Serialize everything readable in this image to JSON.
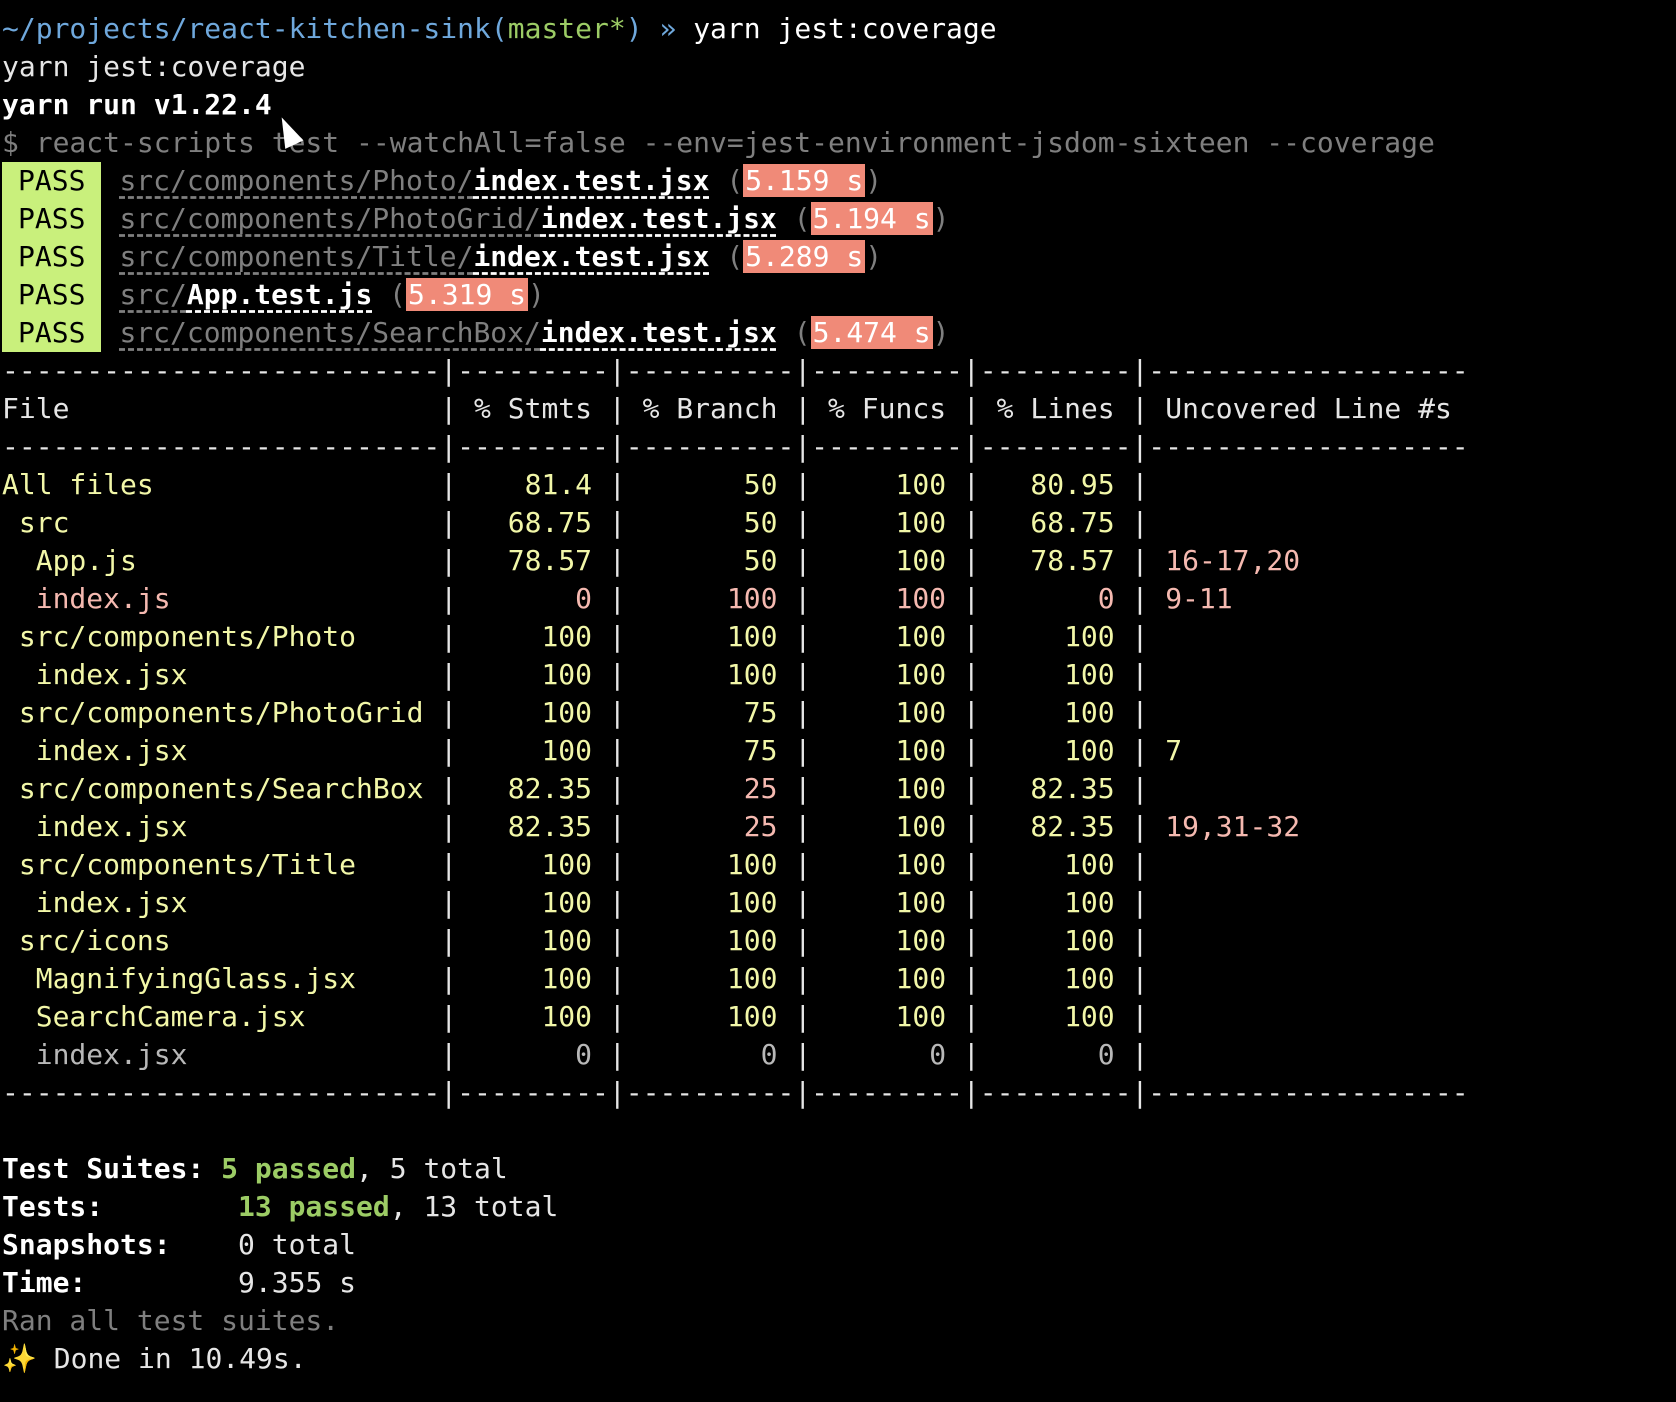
{
  "prompt": {
    "path": "~/projects/react-kitchen-sink",
    "branch": "master*",
    "arrow": "»",
    "command": "yarn jest:coverage"
  },
  "echo_command": "yarn jest:coverage",
  "yarn_version": "yarn run v1.22.4",
  "script_line": "$ react-scripts test --watchAll=false --env=jest-environment-jsdom-sixteen --coverage",
  "pass_label": "PASS",
  "test_results": [
    {
      "dir": "src/components/Photo/",
      "file": "index.test.jsx",
      "time": "5.159 s"
    },
    {
      "dir": "src/components/PhotoGrid/",
      "file": "index.test.jsx",
      "time": "5.194 s"
    },
    {
      "dir": "src/components/Title/",
      "file": "index.test.jsx",
      "time": "5.289 s"
    },
    {
      "dir": "src/",
      "file": "App.test.js",
      "time": "5.319 s"
    },
    {
      "dir": "src/components/SearchBox/",
      "file": "index.test.jsx",
      "time": "5.474 s"
    }
  ],
  "coverage": {
    "separator": "--------------------------|---------|----------|---------|---------|-------------------",
    "headers": [
      "File",
      "% Stmts",
      "% Branch",
      "% Funcs",
      "% Lines",
      "Uncovered Line #s"
    ],
    "rows": [
      {
        "indent": 0,
        "file": "All files",
        "stmts": "81.4",
        "branch": "50",
        "funcs": "100",
        "lines": "80.95",
        "uncovered": "",
        "color": "ycell"
      },
      {
        "indent": 1,
        "file": "src",
        "stmts": "68.75",
        "branch": "50",
        "funcs": "100",
        "lines": "68.75",
        "uncovered": "",
        "color": "ycell"
      },
      {
        "indent": 2,
        "file": "App.js",
        "stmts": "78.57",
        "branch": "50",
        "funcs": "100",
        "lines": "78.57",
        "uncovered": "16-17,20",
        "color": "ycell"
      },
      {
        "indent": 2,
        "file": "index.js",
        "stmts": "0",
        "branch": "100",
        "funcs": "100",
        "lines": "0",
        "uncovered": "9-11",
        "color": "red"
      },
      {
        "indent": 1,
        "file": "src/components/Photo",
        "stmts": "100",
        "branch": "100",
        "funcs": "100",
        "lines": "100",
        "uncovered": "",
        "color": "ycell"
      },
      {
        "indent": 2,
        "file": "index.jsx",
        "stmts": "100",
        "branch": "100",
        "funcs": "100",
        "lines": "100",
        "uncovered": "",
        "color": "ycell"
      },
      {
        "indent": 1,
        "file": "src/components/PhotoGrid",
        "stmts": "100",
        "branch": "75",
        "funcs": "100",
        "lines": "100",
        "uncovered": "",
        "color": "ycell"
      },
      {
        "indent": 2,
        "file": "index.jsx",
        "stmts": "100",
        "branch": "75",
        "funcs": "100",
        "lines": "100",
        "uncovered": "7",
        "color": "ycell"
      },
      {
        "indent": 1,
        "file": "src/components/SearchBox",
        "stmts": "82.35",
        "branch": "25",
        "funcs": "100",
        "lines": "82.35",
        "uncovered": "",
        "color": "ycell"
      },
      {
        "indent": 2,
        "file": "index.jsx",
        "stmts": "82.35",
        "branch": "25",
        "funcs": "100",
        "lines": "82.35",
        "uncovered": "19,31-32",
        "color": "ycell"
      },
      {
        "indent": 1,
        "file": "src/components/Title",
        "stmts": "100",
        "branch": "100",
        "funcs": "100",
        "lines": "100",
        "uncovered": "",
        "color": "ycell"
      },
      {
        "indent": 2,
        "file": "index.jsx",
        "stmts": "100",
        "branch": "100",
        "funcs": "100",
        "lines": "100",
        "uncovered": "",
        "color": "ycell"
      },
      {
        "indent": 1,
        "file": "src/icons",
        "stmts": "100",
        "branch": "100",
        "funcs": "100",
        "lines": "100",
        "uncovered": "",
        "color": "ycell"
      },
      {
        "indent": 2,
        "file": "MagnifyingGlass.jsx",
        "stmts": "100",
        "branch": "100",
        "funcs": "100",
        "lines": "100",
        "uncovered": "",
        "color": "ycell"
      },
      {
        "indent": 2,
        "file": "SearchCamera.jsx",
        "stmts": "100",
        "branch": "100",
        "funcs": "100",
        "lines": "100",
        "uncovered": "",
        "color": "ycell"
      },
      {
        "indent": 2,
        "file": "index.jsx",
        "stmts": "0",
        "branch": "0",
        "funcs": "0",
        "lines": "0",
        "uncovered": "",
        "color": "gray"
      }
    ]
  },
  "summary": {
    "suites_label": "Test Suites:",
    "suites_passed": "5 passed",
    "suites_total": ", 5 total",
    "tests_label": "Tests:",
    "tests_passed": "13 passed",
    "tests_total": ", 13 total",
    "snapshots_label": "Snapshots:",
    "snapshots_value": "0 total",
    "time_label": "Time:",
    "time_value": "9.355 s",
    "ran": "Ran all test suites.",
    "sparkle": "✨",
    "done": " Done in 10.49s."
  },
  "colors": {
    "pass_bg": "#c9f07c",
    "time_bg": "#f08a78",
    "prompt_path": "#6fa8dc",
    "branch": "#9ccc65"
  }
}
